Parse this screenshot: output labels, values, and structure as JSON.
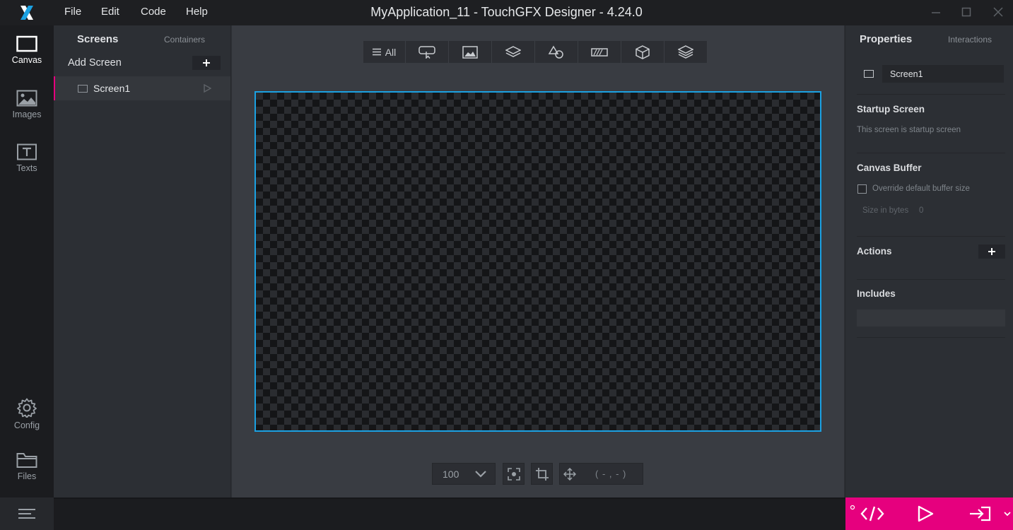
{
  "menu": {
    "file": "File",
    "edit": "Edit",
    "code": "Code",
    "help": "Help"
  },
  "window": {
    "title": "MyApplication_11 - TouchGFX Designer - 4.24.0"
  },
  "nav": {
    "canvas": "Canvas",
    "images": "Images",
    "texts": "Texts",
    "config": "Config",
    "files": "Files"
  },
  "screens_panel": {
    "tab_screens": "Screens",
    "tab_containers": "Containers",
    "add_screen": "Add Screen",
    "screens": [
      {
        "name": "Screen1"
      }
    ]
  },
  "filter_bar": {
    "all_label": "All"
  },
  "zoom": {
    "value": "100"
  },
  "coordinates": {
    "text": "( - , - )"
  },
  "properties": {
    "tab_properties": "Properties",
    "tab_interactions": "Interactions",
    "screen_name": "Screen1",
    "startup_title": "Startup Screen",
    "startup_text": "This screen is startup screen",
    "buffer_title": "Canvas Buffer",
    "buffer_override": "Override default buffer size",
    "size_label": "Size in bytes",
    "size_value": "0",
    "actions_title": "Actions",
    "includes_title": "Includes"
  },
  "colors": {
    "accent": "#e6007e",
    "selection": "#1ba1e2"
  }
}
